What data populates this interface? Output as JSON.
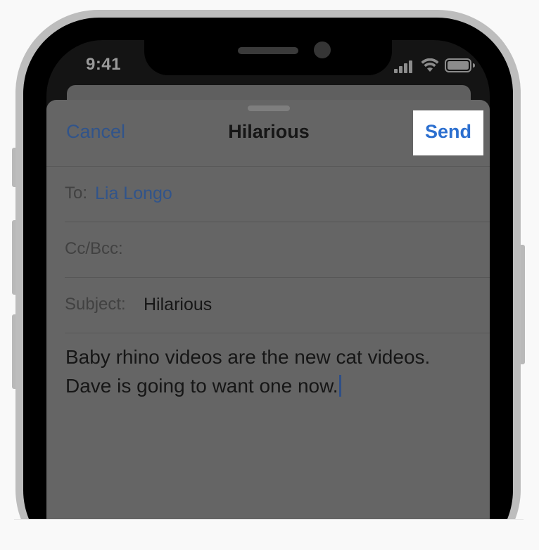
{
  "device": {
    "status_bar": {
      "time": "9:41",
      "icons": [
        "cellular-signal-icon",
        "wifi-icon",
        "battery-icon"
      ]
    }
  },
  "compose": {
    "cancel_label": "Cancel",
    "title": "Hilarious",
    "send_label": "Send",
    "fields": {
      "to_label": "To:",
      "to_value": "Lia Longo",
      "cc_label": "Cc/Bcc:",
      "subject_label": "Subject:",
      "subject_value": "Hilarious"
    },
    "body_lines": [
      "Baby rhino videos are the new cat videos.",
      "Dave is going to want one now."
    ]
  },
  "colors": {
    "link_blue": "#31548a",
    "send_blue": "#2c6fcf",
    "highlight": "#ffffff",
    "dimmed_sheet": "#656565"
  }
}
